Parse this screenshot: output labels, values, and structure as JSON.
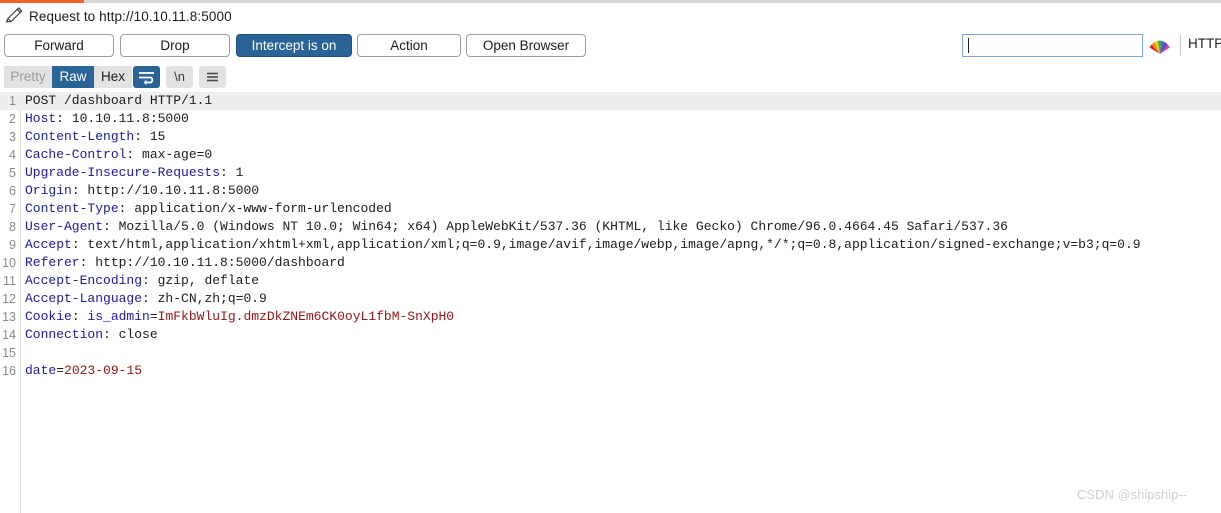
{
  "window": {
    "accent_color": "#ef6426",
    "primary_color": "#2a6496",
    "title": "Request to http://10.10.11.8:5000",
    "pencil_icon": "pencil-icon"
  },
  "toolbar": {
    "forward_label": "Forward",
    "drop_label": "Drop",
    "intercept_label": "Intercept is on",
    "action_label": "Action",
    "open_browser_label": "Open Browser",
    "search_value": "",
    "search_placeholder": "",
    "rainbow_icon": "rainbow-fan-icon",
    "protocol_label": "HTTP"
  },
  "viewbar": {
    "tabs": [
      {
        "label": "Pretty",
        "state": "disabled"
      },
      {
        "label": "Raw",
        "state": "selected"
      },
      {
        "label": "Hex",
        "state": "normal"
      }
    ],
    "word_wrap_icon": "word-wrap-icon",
    "newline_label": "\\n",
    "menu_icon": "hamburger-menu-icon"
  },
  "editor": {
    "lines": [
      {
        "n": "1",
        "current": true,
        "parts": [
          {
            "t": "POST /dashboard HTTP/1.1",
            "c": "v"
          }
        ]
      },
      {
        "n": "2",
        "current": false,
        "parts": [
          {
            "t": "Host",
            "c": "k"
          },
          {
            "t": ": 10.10.11.8:5000",
            "c": "v"
          }
        ]
      },
      {
        "n": "3",
        "current": false,
        "parts": [
          {
            "t": "Content-Length",
            "c": "k"
          },
          {
            "t": ": 15",
            "c": "v"
          }
        ]
      },
      {
        "n": "4",
        "current": false,
        "parts": [
          {
            "t": "Cache-Control",
            "c": "k"
          },
          {
            "t": ": max-age=0",
            "c": "v"
          }
        ]
      },
      {
        "n": "5",
        "current": false,
        "parts": [
          {
            "t": "Upgrade-Insecure-Requests",
            "c": "k"
          },
          {
            "t": ": 1",
            "c": "v"
          }
        ]
      },
      {
        "n": "6",
        "current": false,
        "parts": [
          {
            "t": "Origin",
            "c": "k"
          },
          {
            "t": ": http://10.10.11.8:5000",
            "c": "v"
          }
        ]
      },
      {
        "n": "7",
        "current": false,
        "parts": [
          {
            "t": "Content-Type",
            "c": "k"
          },
          {
            "t": ": application/x-www-form-urlencoded",
            "c": "v"
          }
        ]
      },
      {
        "n": "8",
        "current": false,
        "parts": [
          {
            "t": "User-Agent",
            "c": "k"
          },
          {
            "t": ": Mozilla/5.0 (Windows NT 10.0; Win64; x64) AppleWebKit/537.36 (KHTML, like Gecko) Chrome/96.0.4664.45 Safari/537.36",
            "c": "v"
          }
        ]
      },
      {
        "n": "9",
        "current": false,
        "parts": [
          {
            "t": "Accept",
            "c": "k"
          },
          {
            "t": ": text/html,application/xhtml+xml,application/xml;q=0.9,image/avif,image/webp,image/apng,*/*;q=0.8,application/signed-exchange;v=b3;q=0.9",
            "c": "v"
          }
        ]
      },
      {
        "n": "10",
        "current": false,
        "parts": [
          {
            "t": "Referer",
            "c": "k"
          },
          {
            "t": ": http://10.10.11.8:5000/dashboard",
            "c": "v"
          }
        ]
      },
      {
        "n": "11",
        "current": false,
        "parts": [
          {
            "t": "Accept-Encoding",
            "c": "k"
          },
          {
            "t": ": gzip, deflate",
            "c": "v"
          }
        ]
      },
      {
        "n": "12",
        "current": false,
        "parts": [
          {
            "t": "Accept-Language",
            "c": "k"
          },
          {
            "t": ": zh-CN,zh;q=0.9",
            "c": "v"
          }
        ]
      },
      {
        "n": "13",
        "current": false,
        "parts": [
          {
            "t": "Cookie",
            "c": "k"
          },
          {
            "t": ": ",
            "c": "v"
          },
          {
            "t": "is_admin",
            "c": "k"
          },
          {
            "t": "=",
            "c": "p"
          },
          {
            "t": "ImFkbWluIg.dmzDkZNEm6CK0oyL1fbM-SnXpH0",
            "c": "r"
          }
        ]
      },
      {
        "n": "14",
        "current": false,
        "parts": [
          {
            "t": "Connection",
            "c": "k"
          },
          {
            "t": ": close",
            "c": "v"
          }
        ]
      },
      {
        "n": "15",
        "current": false,
        "parts": []
      },
      {
        "n": "16",
        "current": false,
        "parts": [
          {
            "t": "date",
            "c": "k"
          },
          {
            "t": "=",
            "c": "p"
          },
          {
            "t": "2023-09-15",
            "c": "r"
          }
        ]
      }
    ]
  },
  "watermark": {
    "text": "CSDN @shipship--"
  }
}
